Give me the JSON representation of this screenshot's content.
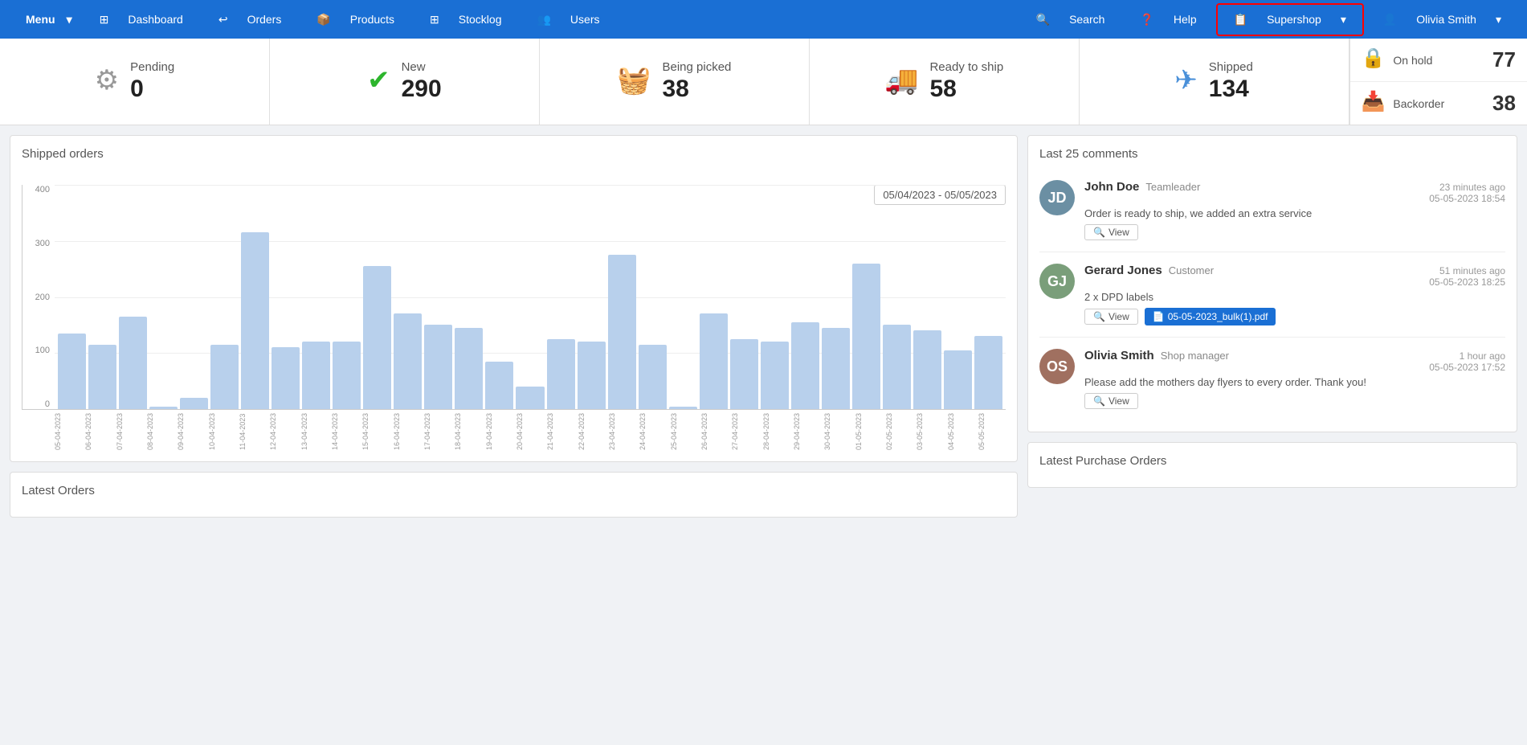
{
  "navbar": {
    "menu_label": "Menu",
    "dashboard_label": "Dashboard",
    "orders_label": "Orders",
    "products_label": "Products",
    "stocklog_label": "Stocklog",
    "users_label": "Users",
    "search_label": "Search",
    "help_label": "Help",
    "supershop_label": "Supershop",
    "user_label": "Olivia Smith"
  },
  "stats": {
    "pending": {
      "label": "Pending",
      "value": "0"
    },
    "new": {
      "label": "New",
      "value": "290"
    },
    "being_picked": {
      "label": "Being picked",
      "value": "38"
    },
    "ready_to_ship": {
      "label": "Ready to ship",
      "value": "58"
    },
    "shipped": {
      "label": "Shipped",
      "value": "134"
    },
    "on_hold": {
      "label": "On hold",
      "value": "77"
    },
    "backorder": {
      "label": "Backorder",
      "value": "38"
    }
  },
  "chart": {
    "title": "Shipped orders",
    "date_range": "05/04/2023 - 05/05/2023",
    "y_labels": [
      "400",
      "300",
      "200",
      "100",
      "0"
    ],
    "bars": [
      135,
      115,
      165,
      5,
      20,
      115,
      315,
      110,
      120,
      120,
      255,
      170,
      150,
      145,
      85,
      40,
      125,
      120,
      275,
      115,
      5,
      170,
      125,
      120,
      155,
      145,
      260,
      150,
      140,
      105,
      130
    ],
    "x_labels": [
      "05-04-2023",
      "06-04-2023",
      "07-04-2023",
      "08-04-2023",
      "09-04-2023",
      "10-04-2023",
      "11-04-2023",
      "12-04-2023",
      "13-04-2023",
      "14-04-2023",
      "15-04-2023",
      "16-04-2023",
      "17-04-2023",
      "18-04-2023",
      "19-04-2023",
      "20-04-2023",
      "21-04-2023",
      "22-04-2023",
      "23-04-2023",
      "24-04-2023",
      "25-04-2023",
      "26-04-2023",
      "27-04-2023",
      "28-04-2023",
      "29-04-2023",
      "30-04-2023",
      "01-05-2023",
      "02-05-2023",
      "03-05-2023",
      "04-05-2023",
      "05-05-2023"
    ]
  },
  "comments": {
    "title": "Last 25 comments",
    "items": [
      {
        "name": "John Doe",
        "role": "Teamleader",
        "time_ago": "23 minutes ago",
        "date": "05-05-2023 18:54",
        "text": "Order is ready to ship, we added an extra service",
        "avatar_class": "av-john",
        "avatar_initials": "JD",
        "has_view": true,
        "has_pdf": false
      },
      {
        "name": "Gerard Jones",
        "role": "Customer",
        "time_ago": "51 minutes ago",
        "date": "05-05-2023 18:25",
        "text": "2 x DPD labels",
        "avatar_class": "av-gerard",
        "avatar_initials": "GJ",
        "has_view": true,
        "has_pdf": true,
        "pdf_label": "05-05-2023_bulk(1).pdf"
      },
      {
        "name": "Olivia Smith",
        "role": "Shop manager",
        "time_ago": "1 hour ago",
        "date": "05-05-2023 17:52",
        "text": "Please add the mothers day flyers to every order. Thank you!",
        "avatar_class": "av-olivia",
        "avatar_initials": "OS",
        "has_view": true,
        "has_pdf": false
      }
    ]
  },
  "latest_orders": {
    "title": "Latest Orders"
  },
  "latest_purchase_orders": {
    "title": "Latest Purchase Orders"
  },
  "view_btn_label": "View",
  "search_icon": "🔍",
  "help_icon": "❓",
  "user_icon": "👤",
  "supershop_icon": "📋",
  "gear_icon": "⚙",
  "check_icon": "✔",
  "basket_icon": "🧺",
  "truck_icon": "🚚",
  "plane_icon": "✈",
  "lock_icon": "🔒",
  "inbox_icon": "📥"
}
